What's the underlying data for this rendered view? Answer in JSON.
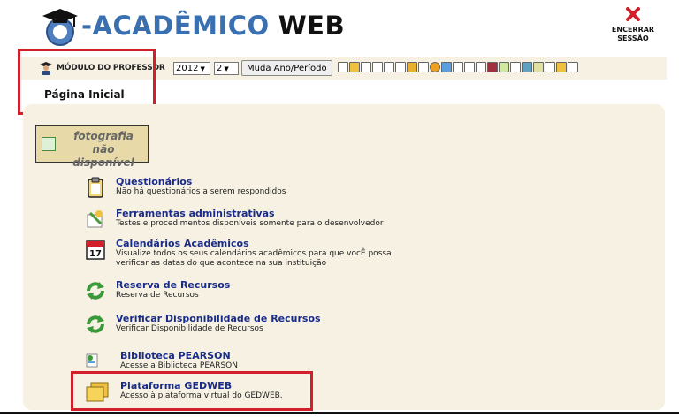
{
  "header": {
    "logo_text": "-ACADÊMICO",
    "logo_web": "WEB",
    "end_session_label": "ENCERRAR\nSESSÃO"
  },
  "toolbar": {
    "module_label": "MÓDULO DO PROFESSOR",
    "year_value": "2012",
    "period_value": "2",
    "change_button": "Muda Ano/Período"
  },
  "page_title": "Página Inicial",
  "photo_placeholder": "fotografia não disponível",
  "items": [
    {
      "title": "Questionários",
      "desc": "Não há questionários a serem respondidos",
      "icon": "clipboard-icon"
    },
    {
      "title": "Ferramentas administrativas",
      "desc": "Testes e procedimentos disponíveis somente para o desenvolvedor",
      "icon": "tools-icon"
    },
    {
      "title": "Calendários Acadêmicos",
      "desc": "Visualize todos os seus calendários acadêmicos para que vocÊ possa",
      "desc2": "verificar as datas do que acontece na sua instituição",
      "icon": "calendar-icon"
    },
    {
      "title": "Reserva de Recursos",
      "desc": "Reserva de Recursos",
      "icon": "refresh-icon"
    },
    {
      "title": "Verificar Disponibilidade de Recursos",
      "desc": "Verificar Disponibilidade de Recursos",
      "icon": "refresh-icon"
    },
    {
      "title": "Biblioteca PEARSON",
      "desc": "Acesse a Biblioteca PEARSON",
      "icon": "library-icon"
    },
    {
      "title": "Plataforma GEDWEB",
      "desc": "Acesso à plataforma virtual do GEDWEB.",
      "icon": "folders-icon"
    }
  ],
  "colors": {
    "accent": "#1a2c8a",
    "highlight": "#d21f2b",
    "panel": "#f6f1e2",
    "logo_blue": "#3a6fb0"
  }
}
